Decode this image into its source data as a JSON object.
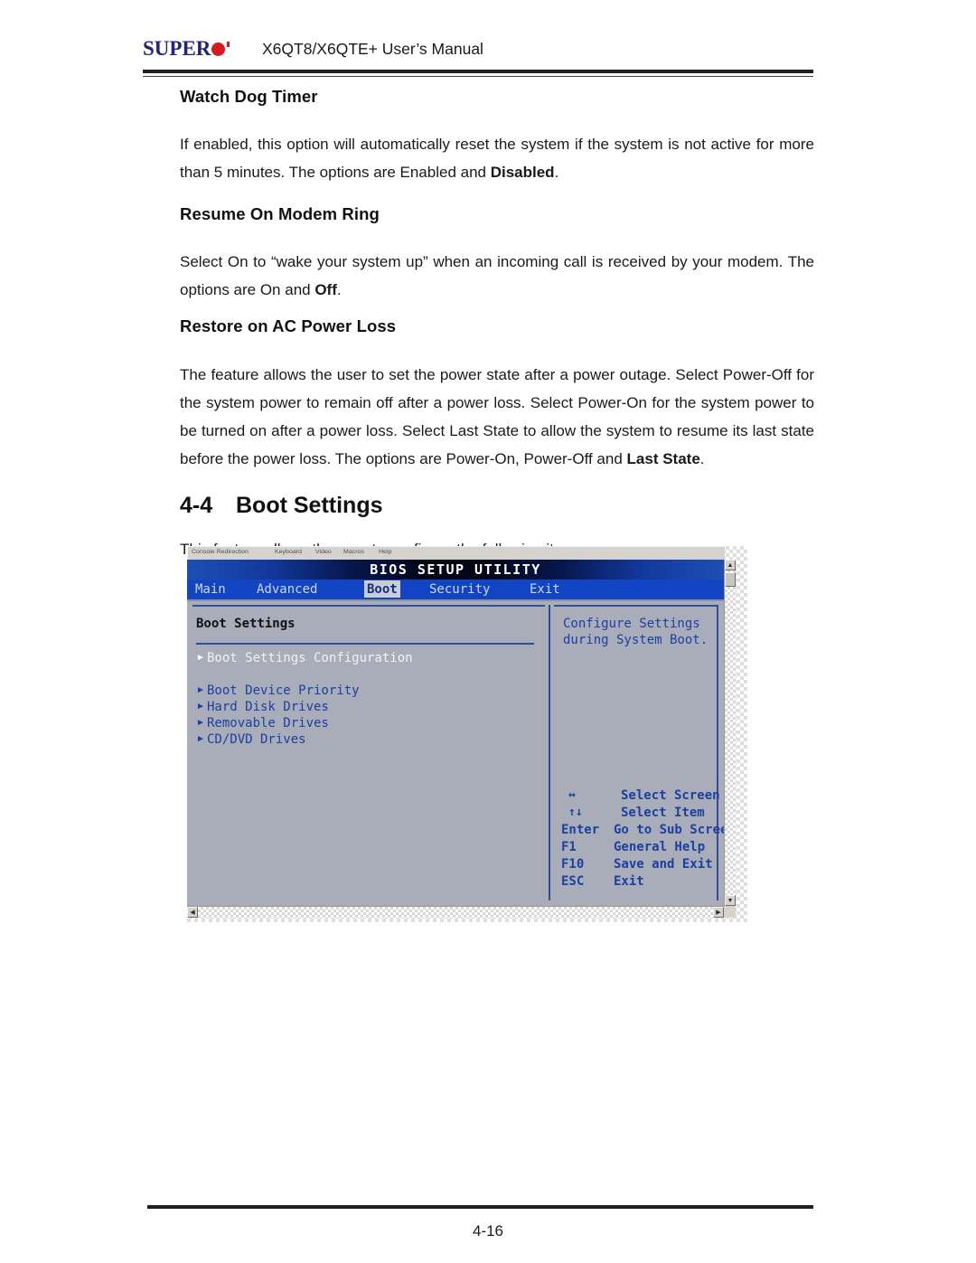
{
  "header": {
    "logo_text": "SUPER",
    "logo_dot": "red-circle",
    "title": "X6QT8/X6QTE+ User’s Manual"
  },
  "sections": [
    {
      "heading": "Watch Dog Timer",
      "paragraph_parts": [
        {
          "text": "If enabled, this option will automatically reset the system if the system is not active for more than 5 minutes.  The options are Enabled and ",
          "bold": false
        },
        {
          "text": "Disabled",
          "bold": true
        },
        {
          "text": ".",
          "bold": false
        }
      ],
      "paragraph_plain": "If enabled, this option will automatically reset the system if the system is not active for more than 5 minutes.  The options are Enabled and Disabled."
    },
    {
      "heading": "Resume On Modem Ring",
      "paragraph_plain": "Select On to “wake your system up” when an incoming call is received by your modem. The options are On and Off."
    },
    {
      "heading": "Restore on AC Power Loss",
      "paragraph_plain": "The feature allows the user to set the power state after a power outage. Select Power-Off for the system power to remain off after a power loss. Select Power-On for the system power to be turned on after a power loss. Select Last State to allow the system to resume its last state before the power loss.  The options are Power-On, Power-Off and Last State."
    }
  ],
  "text": {
    "p1_a": "If enabled, this option will automatically reset the system if the system is not active for more than 5 minutes.  The options are Enabled and ",
    "p1_b": "Disabled",
    "p1_c": ".",
    "p2_a": "Select On to “wake your system up” when an incoming call is received by your modem. The options are On and ",
    "p2_b": "Off",
    "p2_c": ".",
    "p3_a": "The feature allows the user to set the power state after a power outage. Select Power-Off for the system power to remain off after a power loss. Select Power-On for the system power to be turned on after a power loss. Select Last State to allow the system to resume its last state before the power loss.  The options are Power-On, Power-Off and ",
    "p3_b": "Last State",
    "p3_c": "."
  },
  "section": {
    "number": "4-4",
    "title": "Boot Settings",
    "intro": "This feature allows the user to  configure the  following items:"
  },
  "bios": {
    "console_menu": [
      "Console Redirection",
      "Keyboard",
      "Video",
      "Macros",
      "Help"
    ],
    "title": "BIOS SETUP UTILITY",
    "tabs": [
      {
        "label": "Main",
        "active": false
      },
      {
        "label": "Advanced",
        "active": false
      },
      {
        "label": "Boot",
        "active": true
      },
      {
        "label": "Security",
        "active": false
      },
      {
        "label": "Exit",
        "active": false
      }
    ],
    "panel_title": "Boot Settings",
    "menu_items": [
      {
        "label": "Boot Settings Configuration",
        "selected": true
      },
      {
        "label": "Boot Device Priority",
        "selected": false
      },
      {
        "label": "Hard Disk Drives",
        "selected": false
      },
      {
        "label": "Removable Drives",
        "selected": false
      },
      {
        "label": "CD/DVD Drives",
        "selected": false
      }
    ],
    "help_line1": "Configure Settings",
    "help_line2": "during System Boot.",
    "legend": [
      {
        "key": "↔",
        "desc": "Select Screen"
      },
      {
        "key": "↑↓",
        "desc": "Select Item"
      },
      {
        "key": "Enter",
        "desc": "Go to Sub Screen"
      },
      {
        "key": "F1",
        "desc": "General Help"
      },
      {
        "key": "F10",
        "desc": "Save and Exit"
      },
      {
        "key": "ESC",
        "desc": "Exit"
      }
    ],
    "colors": {
      "panel_bg": "#a9adb9",
      "tab_bar": "#1245c3",
      "text_blue": "#1c3fa0",
      "active_tab_bg": "#c9cdd6"
    }
  },
  "footer": {
    "page_number": "4-16"
  }
}
